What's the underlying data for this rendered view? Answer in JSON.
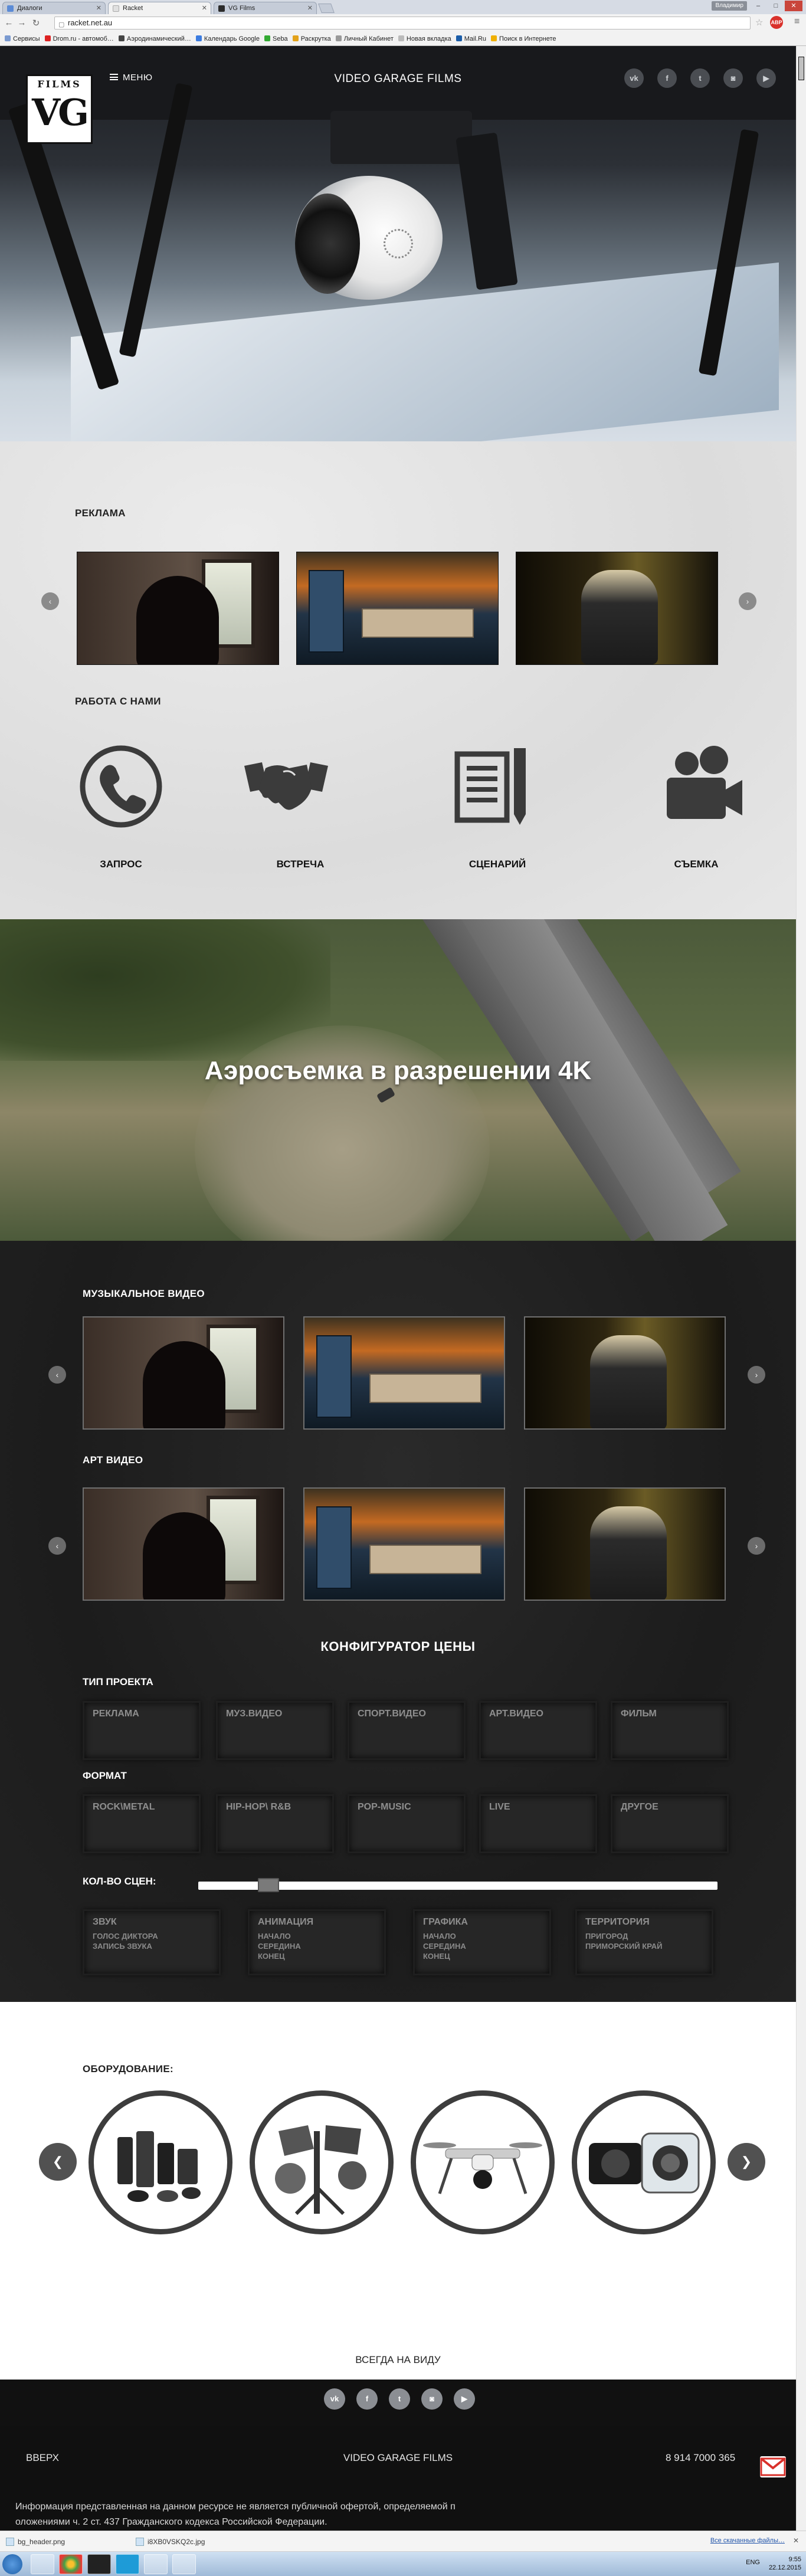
{
  "browser": {
    "tabs": [
      {
        "label": "Диалоги",
        "color": "#5b8bd6"
      },
      {
        "label": "Racket",
        "color": "#e0e0e0"
      },
      {
        "label": "VG Films",
        "color": "#2b2b2b"
      }
    ],
    "profile_label": "Владимир",
    "window_controls": [
      "–",
      "□",
      "✕"
    ],
    "address": "racket.net.au",
    "bookmarks": [
      {
        "label": "Сервисы",
        "color": "#7a9ad0"
      },
      {
        "label": "Drom.ru - автомоб…",
        "color": "#d22"
      },
      {
        "label": "Аэродинамический…",
        "color": "#444"
      },
      {
        "label": "Календарь Google",
        "color": "#3b7be0"
      },
      {
        "label": "Seba",
        "color": "#3a3"
      },
      {
        "label": "Раскрутка",
        "color": "#e3a21a"
      },
      {
        "label": "Личный Кабинет",
        "color": "#999"
      },
      {
        "label": "Новая вкладка",
        "color": "#bbb"
      },
      {
        "label": "Mail.Ru",
        "color": "#1a5ca8"
      },
      {
        "label": "Поиск в Интернете",
        "color": "#f0b000"
      }
    ]
  },
  "site": {
    "logo": {
      "top": "FILMS",
      "main": "VG"
    },
    "menu_label": "МЕНЮ",
    "title": "VIDEO GARAGE FILMS",
    "social_icons": [
      {
        "name": "vk-icon",
        "glyph": "vk"
      },
      {
        "name": "facebook-icon",
        "glyph": "f"
      },
      {
        "name": "twitter-icon",
        "glyph": "t"
      },
      {
        "name": "instagram-icon",
        "glyph": "◙"
      },
      {
        "name": "youtube-icon",
        "glyph": "▶"
      }
    ],
    "ads_title": "РЕКЛАМА",
    "work_title": "РАБОТА С НАМИ",
    "steps": [
      {
        "label": "ЗАПРОС",
        "icon": "phone-icon"
      },
      {
        "label": "ВСТРЕЧА",
        "icon": "handshake-icon"
      },
      {
        "label": "СЦЕНАРИЙ",
        "icon": "script-icon"
      },
      {
        "label": "СЪЕМКА",
        "icon": "camera-icon"
      }
    ],
    "aerial_headline": "Аэросъемка в разрешении 4K",
    "music_title": "МУЗЫКАЛЬНОЕ ВИДЕО",
    "art_title": "АРТ ВИДЕО",
    "configurator": {
      "title": "КОНФИГУРАТОР ЦЕНЫ",
      "project_type_label": "ТИП ПРОЕКТА",
      "project_types": [
        "РЕКЛАМА",
        "МУЗ.ВИДЕО",
        "СПОРТ.ВИДЕО",
        "АРТ.ВИДЕО",
        "ФИЛЬМ"
      ],
      "format_label": "ФОРМАТ",
      "formats": [
        "ROCK\\METAL",
        "HIP-HOP\\ R&B",
        "POP-MUSIC",
        "LIVE",
        "ДРУГОЕ"
      ],
      "scenes_label": "КОЛ-ВО СЦЕН:",
      "scenes_value_fraction": 0.12,
      "options": [
        {
          "title": "ЗВУК",
          "lines": [
            "ГОЛОС ДИКТОРА",
            "ЗАПИСЬ ЗВУКА"
          ]
        },
        {
          "title": "АНИМАЦИЯ",
          "lines": [
            "НАЧАЛО",
            "СЕРЕДИНА",
            "КОНЕЦ"
          ]
        },
        {
          "title": "ГРАФИКА",
          "lines": [
            "НАЧАЛО",
            "СЕРЕДИНА",
            "КОНЕЦ"
          ]
        },
        {
          "title": "ТЕРРИТОРИЯ",
          "lines": [
            "ПРИГОРОД",
            "ПРИМОРСКИЙ КРАЙ"
          ]
        }
      ]
    },
    "equipment_title": "ОБОРУДОВАНИЕ:",
    "equipment_items": [
      "lenses-icon",
      "lights-icon",
      "drone-icon",
      "underwater-camera-icon"
    ],
    "always_visible": "ВСЕГДА НА ВИДУ",
    "footer": {
      "up": "ВВЕРХ",
      "title": "VIDEO GARAGE FILMS",
      "phone": "8 914 7000 365",
      "disclaimer_1": "Информация представленная на данном ресурсе не является публичной офертой, определяемой п",
      "disclaimer_2": "оложениями ч. 2 ст. 437 Гражданского кодекса Российской Федерации."
    }
  },
  "downloads": [
    {
      "label": "bg_header.png"
    },
    {
      "label": "i8XB0VSKQ2c.jpg"
    }
  ],
  "downloads_all": "Все скачанные файлы…",
  "taskbar": {
    "lang": "ENG",
    "time": "9:55",
    "date": "22.12.2015"
  },
  "colors": {
    "accent_red": "#d9312b",
    "dark_bg": "#1c1c1c",
    "paper_bg": "#e2e2e2"
  }
}
